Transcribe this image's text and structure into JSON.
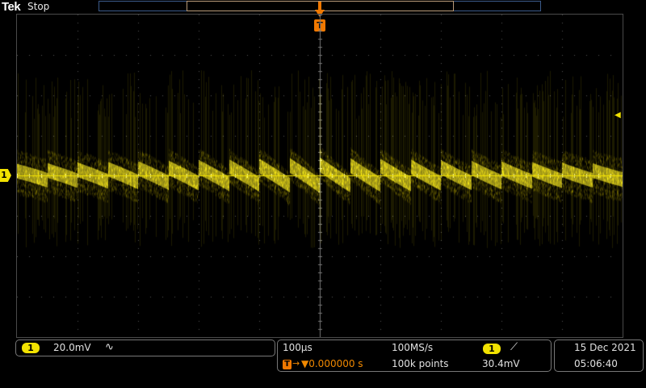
{
  "header": {
    "brand": "Tek",
    "run_status": "Stop"
  },
  "markers": {
    "channel_ground": "1",
    "trigger_position": "T"
  },
  "channel": {
    "number": "1",
    "scale": "20.0mV",
    "coupling_icon": "ac-coupling-icon",
    "coupling_glyph": "∿"
  },
  "timebase": {
    "scale": "100µs",
    "trigger_glyph": "T",
    "trigger_offset": "▼0.000000 s",
    "sample_rate": "100MS/s",
    "record_length": "100k points"
  },
  "trigger": {
    "source": "1",
    "slope_icon": "rising-edge-icon",
    "slope_glyph": "⟋",
    "level": "30.4mV"
  },
  "clock": {
    "date": "15 Dec  2021",
    "time": "05:06:40"
  },
  "colors": {
    "ch1": "#f2e200",
    "trigger": "#f07800",
    "grid": "#4a4a4a"
  }
}
